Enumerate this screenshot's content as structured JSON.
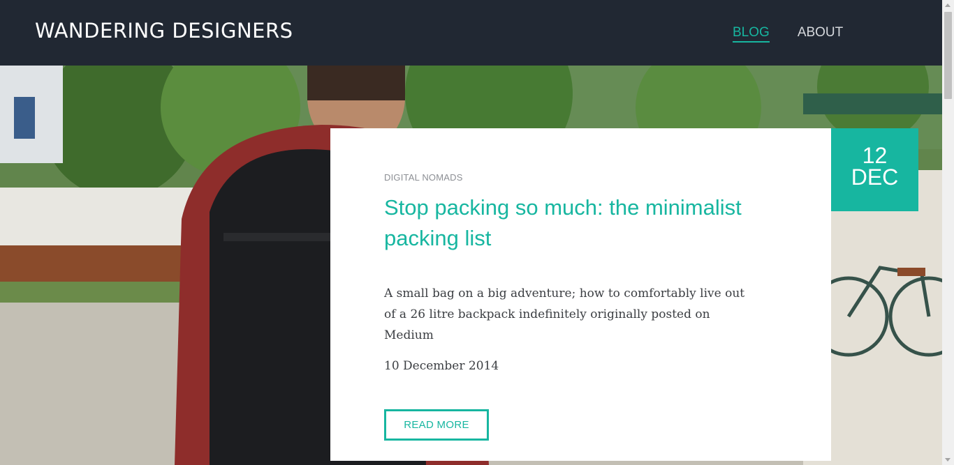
{
  "site": {
    "title": "WANDERING DESIGNERS"
  },
  "nav": [
    {
      "label": "BLOG",
      "active": true
    },
    {
      "label": "ABOUT",
      "active": false
    }
  ],
  "post": {
    "category": "DIGITAL NOMADS",
    "title": "Stop packing so much: the minimalist packing list",
    "excerpt": "A small bag on a big adventure; how to comfortably live out of a 26 litre backpack indefinitely originally posted on Medium",
    "date": "10 December 2014",
    "read_more_label": "READ MORE",
    "badge": {
      "day": "12",
      "month": "DEC"
    }
  },
  "colors": {
    "accent": "#17b6a0",
    "header_bg": "#212833"
  }
}
